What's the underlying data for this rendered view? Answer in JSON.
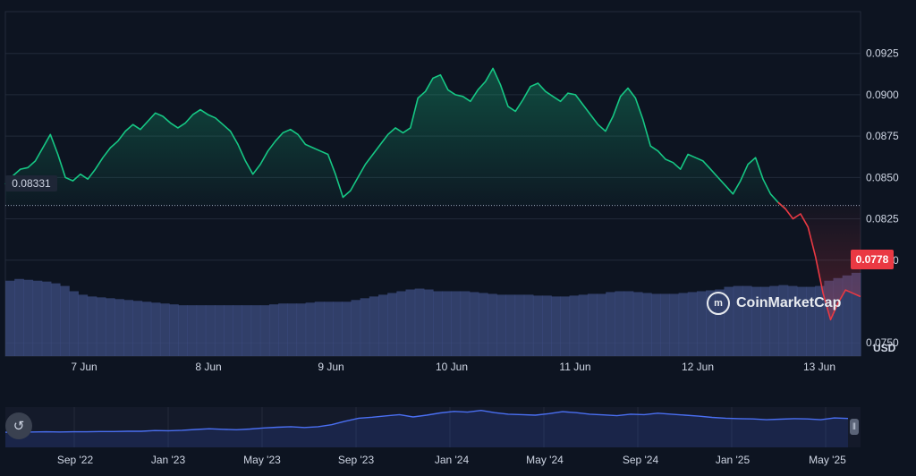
{
  "chart_data": {
    "type": "line",
    "title": "",
    "currency_label": "USD",
    "watermark": "CoinMarketCap",
    "reference_price": "0.08331",
    "current_price": "0.0778",
    "y_ticks": [
      "0.0925",
      "0.0900",
      "0.0875",
      "0.0850",
      "0.0825",
      "0.0800",
      "0.0778",
      "0.0750"
    ],
    "ylim": [
      0.0742,
      0.095
    ],
    "x_ticks": [
      "7 Jun",
      "8 Jun",
      "9 Jun",
      "10 Jun",
      "11 Jun",
      "12 Jun",
      "13 Jun"
    ],
    "x_start": "6 Jun 12:00",
    "series": [
      {
        "values": [
          0.0846,
          0.0851,
          0.0855,
          0.0856,
          0.086,
          0.0868,
          0.0876,
          0.0864,
          0.085,
          0.0848,
          0.0852,
          0.0849,
          0.0855,
          0.0862,
          0.0868,
          0.0872,
          0.0878,
          0.0882,
          0.0879,
          0.0884,
          0.0889,
          0.0887,
          0.0883,
          0.088,
          0.0883,
          0.0888,
          0.0891,
          0.0888,
          0.0886,
          0.0882,
          0.0878,
          0.087,
          0.086,
          0.0852,
          0.0858,
          0.0866,
          0.0872,
          0.0877,
          0.0879,
          0.0876,
          0.087,
          0.0868,
          0.0866,
          0.0864,
          0.0852,
          0.0838,
          0.0842,
          0.085,
          0.0858,
          0.0864,
          0.087,
          0.0876,
          0.088,
          0.0877,
          0.088,
          0.0898,
          0.0902,
          0.091,
          0.0912,
          0.0903,
          0.09,
          0.0899,
          0.0896,
          0.0903,
          0.0908,
          0.0916,
          0.0906,
          0.0893,
          0.089,
          0.0897,
          0.0905,
          0.0907,
          0.0902,
          0.0899,
          0.0896,
          0.0901,
          0.09,
          0.0894,
          0.0888,
          0.0882,
          0.0878,
          0.0887,
          0.0899,
          0.0904,
          0.0898,
          0.0885,
          0.0869,
          0.0866,
          0.0861,
          0.0859,
          0.0855,
          0.0864,
          0.0862,
          0.086,
          0.0855,
          0.085,
          0.0845,
          0.084,
          0.0848,
          0.0858,
          0.0862,
          0.0849,
          0.084,
          0.0835,
          0.0831,
          0.0825,
          0.0828,
          0.082,
          0.0802,
          0.078,
          0.0764,
          0.0774,
          0.0782,
          0.078,
          0.0778
        ],
        "color": "#16c784",
        "down_color": "#ea3943"
      }
    ],
    "volume": {
      "color": "#3d4d82",
      "values": [
        0.86,
        0.88,
        0.87,
        0.86,
        0.85,
        0.83,
        0.8,
        0.74,
        0.7,
        0.68,
        0.67,
        0.66,
        0.65,
        0.64,
        0.63,
        0.62,
        0.61,
        0.6,
        0.59,
        0.58,
        0.58,
        0.58,
        0.58,
        0.58,
        0.58,
        0.58,
        0.58,
        0.58,
        0.58,
        0.59,
        0.6,
        0.6,
        0.6,
        0.61,
        0.62,
        0.62,
        0.62,
        0.62,
        0.64,
        0.66,
        0.68,
        0.7,
        0.72,
        0.74,
        0.76,
        0.77,
        0.76,
        0.74,
        0.74,
        0.74,
        0.74,
        0.73,
        0.72,
        0.71,
        0.7,
        0.7,
        0.7,
        0.7,
        0.69,
        0.69,
        0.68,
        0.68,
        0.69,
        0.7,
        0.71,
        0.71,
        0.73,
        0.74,
        0.74,
        0.73,
        0.72,
        0.71,
        0.71,
        0.71,
        0.72,
        0.73,
        0.74,
        0.75,
        0.76,
        0.79,
        0.8,
        0.8,
        0.79,
        0.79,
        0.8,
        0.81,
        0.8,
        0.79,
        0.79,
        0.8,
        0.86,
        0.89,
        0.92,
        0.95
      ]
    },
    "overview": {
      "x_ticks": [
        "Sep '22",
        "Jan '23",
        "May '23",
        "Sep '23",
        "Jan '24",
        "May '24",
        "Sep '24",
        "Jan '25",
        "May '25"
      ],
      "values": [
        0.06,
        0.061,
        0.061,
        0.062,
        0.061,
        0.062,
        0.062,
        0.063,
        0.063,
        0.064,
        0.064,
        0.067,
        0.066,
        0.068,
        0.071,
        0.074,
        0.072,
        0.07,
        0.073,
        0.077,
        0.08,
        0.082,
        0.079,
        0.082,
        0.09,
        0.104,
        0.116,
        0.12,
        0.125,
        0.13,
        0.121,
        0.128,
        0.137,
        0.143,
        0.14,
        0.147,
        0.138,
        0.132,
        0.13,
        0.128,
        0.134,
        0.142,
        0.138,
        0.132,
        0.129,
        0.126,
        0.132,
        0.13,
        0.136,
        0.132,
        0.128,
        0.124,
        0.119,
        0.116,
        0.114,
        0.113,
        0.11,
        0.112,
        0.114,
        0.113,
        0.11,
        0.117,
        0.115
      ]
    }
  }
}
